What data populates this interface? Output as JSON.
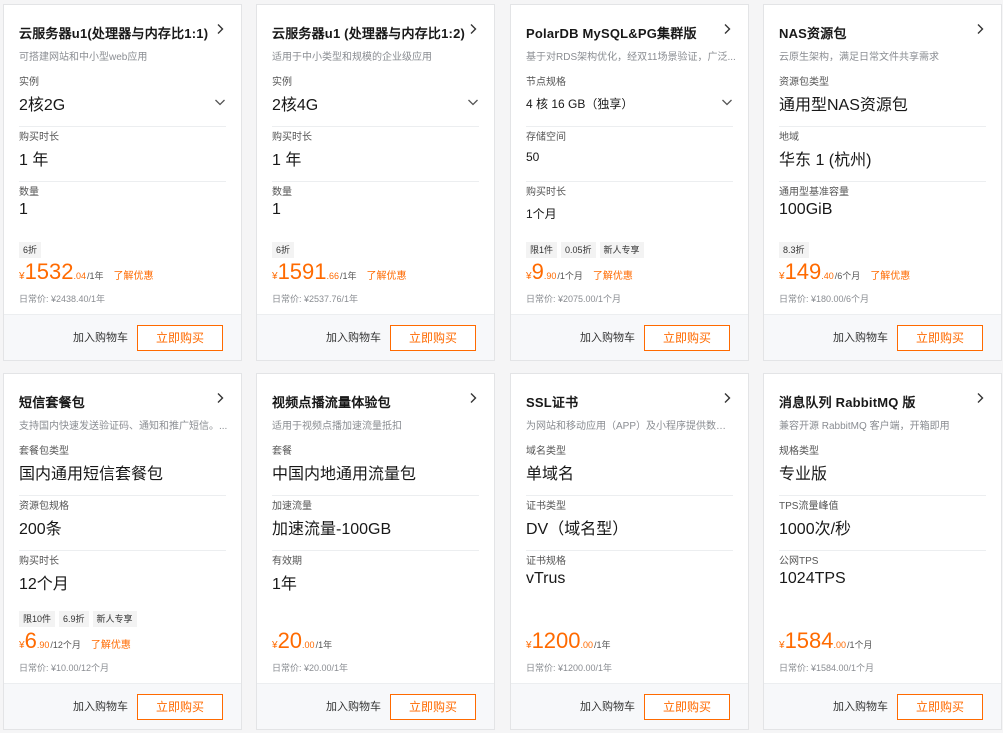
{
  "colors": {
    "accent": "#ff6a00",
    "border": "#e3e4e6",
    "background": "#f5f5f6"
  },
  "cards": [
    {
      "title": "云服务器u1(处理器与内存比1:1)",
      "desc": "可搭建网站和中小型web应用",
      "fields": [
        {
          "label": "实例",
          "value": "2核2G",
          "dropdown": true
        },
        {
          "label": "购买时长",
          "value": "1 年"
        },
        {
          "label": "数量",
          "value": "1"
        }
      ],
      "tags": [
        "6折"
      ],
      "price": {
        "yen": "¥",
        "int": "1532",
        "dec": ".04",
        "unit": "/1年"
      },
      "promo": "了解优惠",
      "original": "日常价: ¥2438.40/1年",
      "cart": "加入购物车",
      "buy": "立即购买"
    },
    {
      "title": "云服务器u1 (处理器与内存比1:2)",
      "desc": "适用于中小类型和规模的企业级应用",
      "fields": [
        {
          "label": "实例",
          "value": "2核4G",
          "dropdown": true
        },
        {
          "label": "购买时长",
          "value": "1 年"
        },
        {
          "label": "数量",
          "value": "1"
        }
      ],
      "tags": [
        "6折"
      ],
      "price": {
        "yen": "¥",
        "int": "1591",
        "dec": ".66",
        "unit": "/1年"
      },
      "promo": "了解优惠",
      "original": "日常价: ¥2537.76/1年",
      "cart": "加入购物车",
      "buy": "立即购买"
    },
    {
      "title": "PolarDB MySQL&PG集群版",
      "desc": "基于对RDS架构优化，经双11场景验证，广泛...",
      "fields": [
        {
          "label": "节点规格",
          "value": "4 核 16 GB（独享）",
          "dropdown": true,
          "small": true
        },
        {
          "label": "存储空间",
          "value": "50",
          "small": true
        },
        {
          "label": "购买时长",
          "value": "1个月",
          "small": true
        }
      ],
      "tags": [
        "限1件",
        "0.05折",
        "新人专享"
      ],
      "price": {
        "yen": "¥",
        "int": "9",
        "dec": ".90",
        "unit": "/1个月"
      },
      "promo": "了解优惠",
      "original": "日常价: ¥2075.00/1个月",
      "cart": "加入购物车",
      "buy": "立即购买"
    },
    {
      "title": "NAS资源包",
      "desc": "云原生架构，满足日常文件共享需求",
      "fields": [
        {
          "label": "资源包类型",
          "value": "通用型NAS资源包"
        },
        {
          "label": "地域",
          "value": "华东 1 (杭州)"
        },
        {
          "label": "通用型基准容量",
          "value": "100GiB"
        }
      ],
      "tags": [
        "8.3折"
      ],
      "price": {
        "yen": "¥",
        "int": "149",
        "dec": ".40",
        "unit": "/6个月"
      },
      "promo": "了解优惠",
      "original": "日常价: ¥180.00/6个月",
      "cart": "加入购物车",
      "buy": "立即购买"
    },
    {
      "title": "短信套餐包",
      "desc": "支持国内快速发送验证码、通知和推广短信。...",
      "fields": [
        {
          "label": "套餐包类型",
          "value": "国内通用短信套餐包"
        },
        {
          "label": "资源包规格",
          "value": "200条"
        },
        {
          "label": "购买时长",
          "value": "12个月"
        }
      ],
      "tags": [
        "限10件",
        "6.9折",
        "新人专享"
      ],
      "price": {
        "yen": "¥",
        "int": "6",
        "dec": ".90",
        "unit": "/12个月"
      },
      "promo": "了解优惠",
      "original": "日常价: ¥10.00/12个月",
      "cart": "加入购物车",
      "buy": "立即购买"
    },
    {
      "title": "视频点播流量体验包",
      "desc": "适用于视频点播加速流量抵扣",
      "fields": [
        {
          "label": "套餐",
          "value": "中国内地通用流量包"
        },
        {
          "label": "加速流量",
          "value": "加速流量-100GB"
        },
        {
          "label": "有效期",
          "value": "1年"
        }
      ],
      "tags": [],
      "price": {
        "yen": "¥",
        "int": "20",
        "dec": ".00",
        "unit": "/1年"
      },
      "promo": "",
      "original": "日常价: ¥20.00/1年",
      "cart": "加入购物车",
      "buy": "立即购买"
    },
    {
      "title": "SSL证书",
      "desc": "为网站和移动应用（APP）及小程序提供数据H...",
      "fields": [
        {
          "label": "域名类型",
          "value": "单域名"
        },
        {
          "label": "证书类型",
          "value": "DV（域名型）"
        },
        {
          "label": "证书规格",
          "value": "vTrus"
        }
      ],
      "tags": [],
      "price": {
        "yen": "¥",
        "int": "1200",
        "dec": ".00",
        "unit": "/1年"
      },
      "promo": "",
      "original": "日常价: ¥1200.00/1年",
      "cart": "加入购物车",
      "buy": "立即购买"
    },
    {
      "title": "消息队列 RabbitMQ 版",
      "desc": "兼容开源 RabbitMQ 客户端，开箱即用",
      "fields": [
        {
          "label": "规格类型",
          "value": "专业版"
        },
        {
          "label": "TPS流量峰值",
          "value": "1000次/秒"
        },
        {
          "label": "公网TPS",
          "value": "1024TPS"
        }
      ],
      "tags": [],
      "price": {
        "yen": "¥",
        "int": "1584",
        "dec": ".00",
        "unit": "/1个月"
      },
      "promo": "",
      "original": "日常价: ¥1584.00/1个月",
      "cart": "加入购物车",
      "buy": "立即购买"
    }
  ]
}
